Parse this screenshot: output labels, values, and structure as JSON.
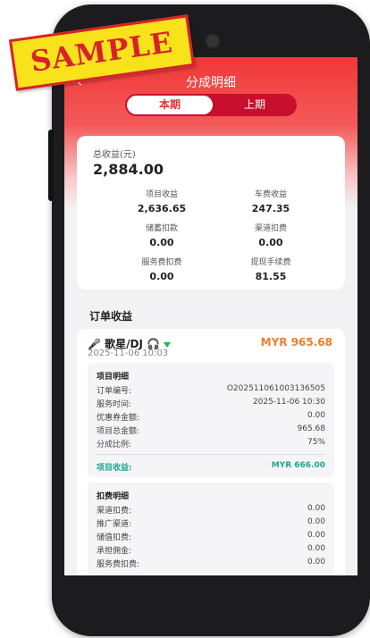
{
  "header": {
    "back_icon": "chevron-left-icon",
    "title": "分成明细",
    "tabs": [
      "本期",
      "上期"
    ]
  },
  "summary": {
    "total_label": "总收益(元)",
    "total_value": "2,884.00",
    "items": [
      {
        "label": "项目收益",
        "value": "2,636.65"
      },
      {
        "label": "车费收益",
        "value": "247.35"
      },
      {
        "label": "储蓄扣款",
        "value": "0.00"
      },
      {
        "label": "渠道扣费",
        "value": "0.00"
      },
      {
        "label": "服务费扣费",
        "value": "0.00"
      },
      {
        "label": "提现手续费",
        "value": "81.55"
      }
    ]
  },
  "orders": {
    "section_title": "订单收益",
    "order": {
      "role": "🎤 歌星/DJ 🎧",
      "amount": "MYR 965.68",
      "date": "2025-11-06 10:03",
      "project": {
        "title": "项目明细",
        "rows": [
          {
            "k": "订单编号:",
            "v": "O202511061003136505"
          },
          {
            "k": "服务时间:",
            "v": "2025-11-06 10:30"
          },
          {
            "k": "优惠券金额:",
            "v": "0.00"
          },
          {
            "k": "项目总金额:",
            "v": "965.68"
          },
          {
            "k": "分成比例:",
            "v": "75%"
          }
        ],
        "income_label": "项目收益:",
        "income_value": "MYR 666.00"
      },
      "deduction": {
        "title": "扣费明细",
        "rows": [
          {
            "k": "渠道扣费:",
            "v": "0.00"
          },
          {
            "k": "推广渠道:",
            "v": "0.00"
          },
          {
            "k": "储值扣费:",
            "v": "0.00"
          },
          {
            "k": "承担佣金:",
            "v": "0.00"
          },
          {
            "k": "服务费扣费:",
            "v": "0.00"
          }
        ]
      }
    }
  },
  "watermark": "SAMPLE",
  "colors": {
    "primary_red": "#f03737",
    "amount_orange": "#ef7d2c",
    "income_green": "#1aa78a"
  }
}
